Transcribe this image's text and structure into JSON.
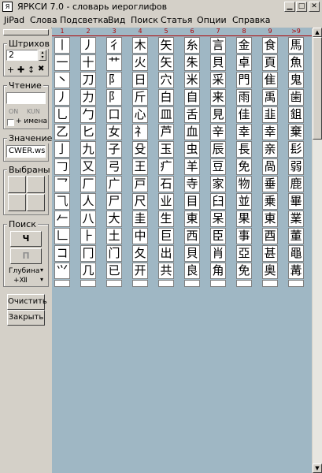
{
  "window": {
    "title": "ЯРКСИ 7.0   -  словарь иероглифов",
    "icon_text": "Я",
    "minimize_glyph": "▁",
    "maximize_glyph": "□",
    "close_glyph": "✕"
  },
  "menu": [
    {
      "label": "JiPad"
    },
    {
      "label": "Слова"
    },
    {
      "label": "Подсветка"
    },
    {
      "label": "Вид"
    },
    {
      "label": "Поиск"
    },
    {
      "label": "Статья"
    },
    {
      "label": "Опции"
    },
    {
      "label": "Справка"
    }
  ],
  "left": {
    "strokes_title": "Штрихов",
    "strokes_value": "2",
    "strokes_glyphs": [
      "+",
      "✚",
      "↕",
      "✖"
    ],
    "reading_title": "Чтение",
    "reading_value": "",
    "on_label": "ON",
    "kun_label": "KUN",
    "names_label": "+ имена",
    "meaning_title": "Значение",
    "meaning_value": "CWER.ws",
    "chosen_title": "Выбраны",
    "search_title": "Поиск",
    "search_btn1": "Ч",
    "search_btn2": "П",
    "depth_label": "Глубина",
    "depth_symbol": "+Ⅻ",
    "clear_label": "Очистить",
    "close_label": "Закрыть"
  },
  "grid": {
    "headers": [
      "1",
      "2",
      "3",
      "4",
      "5",
      "6",
      "7",
      "8",
      "9",
      ">9"
    ],
    "columns": [
      [
        "丨",
        "一",
        "丶",
        "丿",
        "乚",
        "乙",
        "亅",
        "𠃌",
        "乛",
        "⺄",
        "𠂉",
        "𠃊",
        "コ",
        "⺍"
      ],
      [
        "丿",
        "十",
        "刀",
        "力",
        "勹",
        "匕",
        "九",
        "又",
        "厂",
        "人",
        "八",
        "⺊",
        "冂",
        "几"
      ],
      [
        "彳",
        "艹",
        "阝",
        "阝",
        "口",
        "女",
        "子",
        "弓",
        "广",
        "尸",
        "大",
        "土",
        "门",
        "已"
      ],
      [
        "木",
        "火",
        "日",
        "斤",
        "心",
        "礻",
        "殳",
        "王",
        "戸",
        "尺",
        "圭",
        "中",
        "夂",
        "开"
      ],
      [
        "矢",
        "矢",
        "穴",
        "白",
        "皿",
        "芦",
        "玉",
        "疒",
        "石",
        "业",
        "生",
        "巨",
        "出",
        "共"
      ],
      [
        "糸",
        "朱",
        "米",
        "自",
        "舌",
        "血",
        "虫",
        "羊",
        "寺",
        "目",
        "東",
        "西",
        "貝",
        "良"
      ],
      [
        "言",
        "貝",
        "采",
        "来",
        "見",
        "辛",
        "辰",
        "豆",
        "家",
        "臼",
        "呆",
        "臣",
        "肖",
        "角"
      ],
      [
        "金",
        "卓",
        "門",
        "雨",
        "佳",
        "幸",
        "長",
        "免",
        "物",
        "並",
        "果",
        "事",
        "亞",
        "免"
      ],
      [
        "食",
        "頁",
        "隹",
        "禹",
        "韭",
        "幸",
        "亲",
        "咼",
        "垂",
        "乗",
        "東",
        "酉",
        "甚",
        "奥"
      ],
      [
        "馬",
        "魚",
        "鬼",
        "歯",
        "鉏",
        "棄",
        "髟",
        "弱",
        "鹿",
        "畢",
        "業",
        "董",
        "黽",
        "冓"
      ]
    ]
  },
  "scroll": {
    "up_glyph": "▲",
    "down_glyph": "▼"
  }
}
